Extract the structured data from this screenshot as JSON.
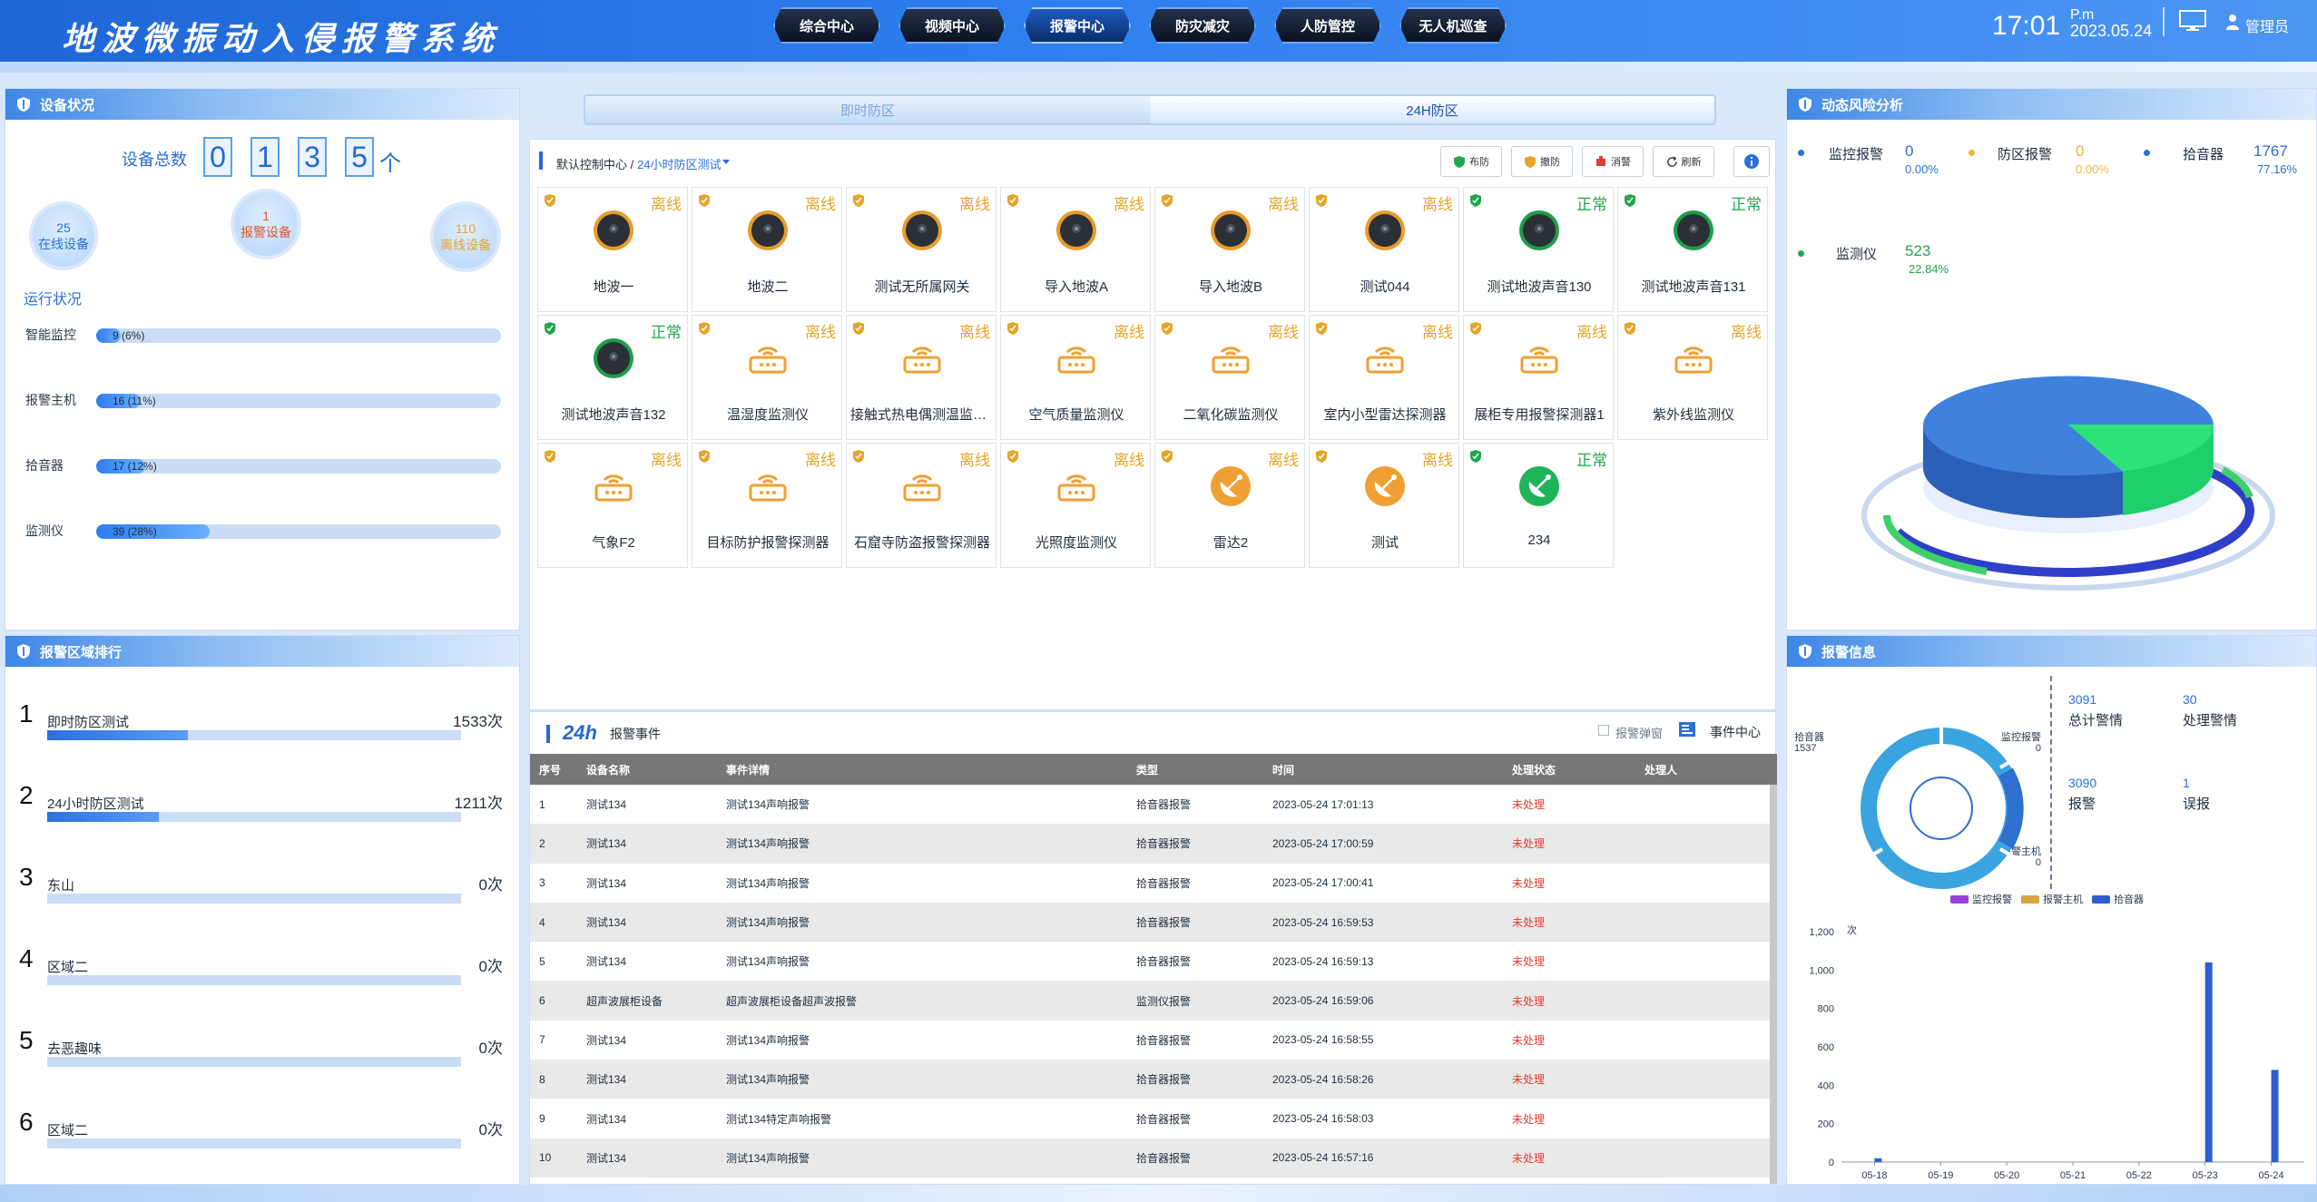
{
  "header": {
    "title": "地波微振动入侵报警系统",
    "nav": [
      {
        "label": "综合中心",
        "active": false
      },
      {
        "label": "视频中心",
        "active": false
      },
      {
        "label": "报警中心",
        "active": true
      },
      {
        "label": "防灾减灾",
        "active": false
      },
      {
        "label": "人防管控",
        "active": false
      },
      {
        "label": "无人机巡查",
        "active": false
      }
    ],
    "time": "17:01",
    "ampm": "P.m",
    "date": "2023.05.24",
    "user": "管理员",
    "monitor_icon": "monitor-icon",
    "user_icon": "user-icon"
  },
  "device_status": {
    "title": "设备状况",
    "total_label": "设备总数",
    "total_digits": [
      "0",
      "1",
      "3",
      "5"
    ],
    "unit": "个",
    "online": {
      "count": "25",
      "label": "在线设备"
    },
    "alarm": {
      "count": "1",
      "label": "报警设备"
    },
    "offline": {
      "count": "110",
      "label": "离线设备"
    },
    "run_title": "运行状况",
    "run_items": [
      {
        "label": "智能监控",
        "value": "9 (6%)",
        "fraction": 0.06
      },
      {
        "label": "报警主机",
        "value": "16 (11%)",
        "fraction": 0.11
      },
      {
        "label": "拾音器",
        "value": "17 (12%)",
        "fraction": 0.12
      },
      {
        "label": "监测仪",
        "value": "39 (28%)",
        "fraction": 0.28
      }
    ]
  },
  "alarm_ranking": {
    "title": "报警区域排行",
    "items": [
      {
        "rank": "1",
        "name": "即时防区测试",
        "count": "1533次",
        "fraction": 0.34
      },
      {
        "rank": "2",
        "name": "24小时防区测试",
        "count": "1211次",
        "fraction": 0.27
      },
      {
        "rank": "3",
        "name": "东山",
        "count": "0次",
        "fraction": 0
      },
      {
        "rank": "4",
        "name": "区域二",
        "count": "0次",
        "fraction": 0
      },
      {
        "rank": "5",
        "name": "去恶趣味",
        "count": "0次",
        "fraction": 0
      },
      {
        "rank": "6",
        "name": "区域二",
        "count": "0次",
        "fraction": 0
      }
    ]
  },
  "zone_tabs": [
    {
      "label": "即时防区",
      "active": false
    },
    {
      "label": "24H防区",
      "active": true
    }
  ],
  "device_grid": {
    "breadcrumb": [
      "默认控制中心 /",
      "24小时防区测试"
    ],
    "toolbar": [
      {
        "label": "布防",
        "icon": "arm-shield-icon",
        "color": "#22a74c"
      },
      {
        "label": "撤防",
        "icon": "disarm-shield-icon",
        "color": "#e5a52a"
      },
      {
        "label": "消警",
        "icon": "clear-alarm-icon",
        "color": "#e23a2e"
      },
      {
        "label": "刷新",
        "icon": "refresh-icon",
        "color": "#333333"
      }
    ],
    "info_icon": "info-icon",
    "devices": [
      {
        "name": "地波一",
        "status": "离线",
        "state": "off",
        "icon": "geo-sensor-icon"
      },
      {
        "name": "地波二",
        "status": "离线",
        "state": "off",
        "icon": "geo-sensor-icon"
      },
      {
        "name": "测试无所属网关",
        "status": "离线",
        "state": "off",
        "icon": "geo-sensor-icon"
      },
      {
        "name": "导入地波A",
        "status": "离线",
        "state": "off",
        "icon": "geo-sensor-icon"
      },
      {
        "name": "导入地波B",
        "status": "离线",
        "state": "off",
        "icon": "geo-sensor-icon"
      },
      {
        "name": "测试044",
        "status": "离线",
        "state": "off",
        "icon": "geo-sensor-icon"
      },
      {
        "name": "测试地波声音130",
        "status": "正常",
        "state": "on",
        "icon": "geo-sensor-icon"
      },
      {
        "name": "测试地波声音131",
        "status": "正常",
        "state": "on",
        "icon": "geo-sensor-icon"
      },
      {
        "name": "测试地波声音132",
        "status": "正常",
        "state": "on",
        "icon": "geo-sensor-icon"
      },
      {
        "name": "温湿度监测仪",
        "status": "离线",
        "state": "off",
        "icon": "router-icon"
      },
      {
        "name": "接触式热电偶测温监测仪",
        "status": "离线",
        "state": "off",
        "icon": "router-icon"
      },
      {
        "name": "空气质量监测仪",
        "status": "离线",
        "state": "off",
        "icon": "router-icon"
      },
      {
        "name": "二氧化碳监测仪",
        "status": "离线",
        "state": "off",
        "icon": "router-icon"
      },
      {
        "name": "室内小型雷达探测器",
        "status": "离线",
        "state": "off",
        "icon": "router-icon"
      },
      {
        "name": "展柜专用报警探测器1",
        "status": "离线",
        "state": "off",
        "icon": "router-icon"
      },
      {
        "name": "紫外线监测仪",
        "status": "离线",
        "state": "off",
        "icon": "router-icon"
      },
      {
        "name": "气象F2",
        "status": "离线",
        "state": "off",
        "icon": "router-icon"
      },
      {
        "name": "目标防护报警探测器",
        "status": "离线",
        "state": "off",
        "icon": "router-icon"
      },
      {
        "name": "石窟寺防盗报警探测器",
        "status": "离线",
        "state": "off",
        "icon": "router-icon"
      },
      {
        "name": "光照度监测仪",
        "status": "离线",
        "state": "off",
        "icon": "router-icon"
      },
      {
        "name": "雷达2",
        "status": "离线",
        "state": "off",
        "icon": "radar-dish-icon"
      },
      {
        "name": "测试",
        "status": "离线",
        "state": "off",
        "icon": "radar-dish-icon"
      },
      {
        "name": "234",
        "status": "正常",
        "state": "on",
        "icon": "radar-dish-icon"
      }
    ]
  },
  "events": {
    "logo": "24h",
    "title": "报警事件",
    "popup_label": "报警弹窗",
    "center_label": "事件中心",
    "columns": [
      "序号",
      "设备名称",
      "事件详情",
      "类型",
      "时间",
      "处理状态",
      "处理人"
    ],
    "rows": [
      [
        "1",
        "测试134",
        "测试134声响报警",
        "拾音器报警",
        "2023-05-24 17:01:13",
        "未处理",
        ""
      ],
      [
        "2",
        "测试134",
        "测试134声响报警",
        "拾音器报警",
        "2023-05-24 17:00:59",
        "未处理",
        ""
      ],
      [
        "3",
        "测试134",
        "测试134声响报警",
        "拾音器报警",
        "2023-05-24 17:00:41",
        "未处理",
        ""
      ],
      [
        "4",
        "测试134",
        "测试134声响报警",
        "拾音器报警",
        "2023-05-24 16:59:53",
        "未处理",
        ""
      ],
      [
        "5",
        "测试134",
        "测试134声响报警",
        "拾音器报警",
        "2023-05-24 16:59:13",
        "未处理",
        ""
      ],
      [
        "6",
        "超声波展柜设备",
        "超声波展柜设备超声波报警",
        "监测仪报警",
        "2023-05-24 16:59:06",
        "未处理",
        ""
      ],
      [
        "7",
        "测试134",
        "测试134声响报警",
        "拾音器报警",
        "2023-05-24 16:58:55",
        "未处理",
        ""
      ],
      [
        "8",
        "测试134",
        "测试134声响报警",
        "拾音器报警",
        "2023-05-24 16:58:26",
        "未处理",
        ""
      ],
      [
        "9",
        "测试134",
        "测试134特定声响报警",
        "拾音器报警",
        "2023-05-24 16:58:03",
        "未处理",
        ""
      ],
      [
        "10",
        "测试134",
        "测试134声响报警",
        "拾音器报警",
        "2023-05-24 16:57:16",
        "未处理",
        ""
      ]
    ]
  },
  "risk": {
    "title": "动态风险分析",
    "legend": [
      {
        "name": "监控报警",
        "value": "0",
        "pct": "0.00%",
        "color": "#2c6fd6",
        "dot": "#2c6fd6"
      },
      {
        "name": "防区报警",
        "value": "0",
        "pct": "0.00%",
        "color": "#f0b63a",
        "dot": "#f0b63a"
      },
      {
        "name": "拾音器",
        "value": "1767",
        "pct": "77.16%",
        "color": "#2c6fd6",
        "dot": "#2c6fd6"
      },
      {
        "name": "监测仪",
        "value": "523",
        "pct": "22.84%",
        "color": "#22a74c",
        "dot": "#22a74c"
      }
    ],
    "pie": [
      {
        "name": "拾音器",
        "value": 1767,
        "color": "#3f82de"
      },
      {
        "name": "监测仪",
        "value": 523,
        "color": "#2ee27a"
      }
    ]
  },
  "alarm_info": {
    "title": "报警信息",
    "donut_labels": [
      {
        "name": "拾音器",
        "value": "1537"
      },
      {
        "name": "监控报警",
        "value": "0"
      },
      {
        "name": "报警主机",
        "value": "0"
      }
    ],
    "stats": [
      {
        "num": "3091",
        "label": "总计警情"
      },
      {
        "num": "30",
        "label": "处理警情"
      },
      {
        "num": "3090",
        "label": "报警"
      },
      {
        "num": "1",
        "label": "误报"
      }
    ]
  },
  "chart_data": {
    "type": "bar",
    "title": "",
    "xlabel": "",
    "ylabel": "次",
    "ylim": [
      0,
      1200
    ],
    "yticks": [
      "0",
      "200",
      "400",
      "600",
      "800",
      "1,000",
      "1,200"
    ],
    "categories": [
      "05-18",
      "05-19",
      "05-20",
      "05-21",
      "05-22",
      "05-23",
      "05-24"
    ],
    "series": [
      {
        "name": "监控报警",
        "values": [
          0,
          0,
          0,
          0,
          0,
          0,
          0
        ],
        "color": "#9b3fd9"
      },
      {
        "name": "报警主机",
        "values": [
          0,
          0,
          0,
          0,
          0,
          0,
          0
        ],
        "color": "#d9a640"
      },
      {
        "name": "拾音器",
        "values": [
          20,
          0,
          0,
          0,
          0,
          1040,
          480
        ],
        "color": "#2f5fcf"
      }
    ],
    "legend_position": "top",
    "grid": false
  }
}
